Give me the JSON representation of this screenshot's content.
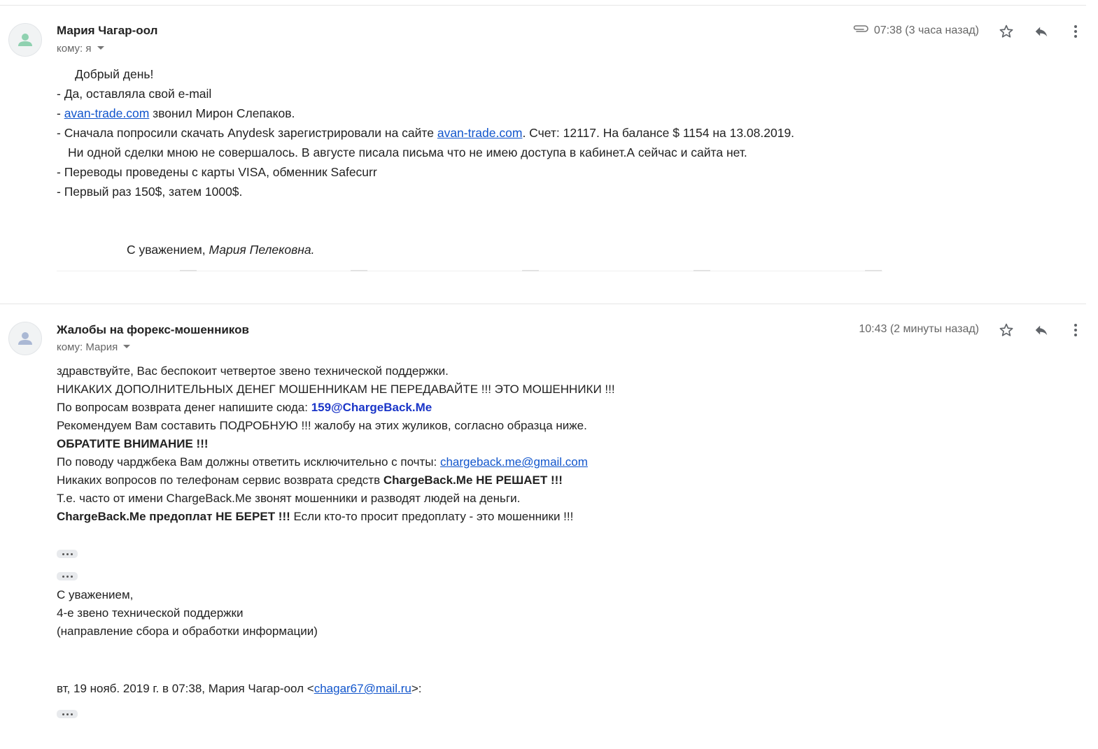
{
  "message1": {
    "sender": "Мария Чагар-оол",
    "recipient": "кому: я",
    "time": "07:38 (3 часа назад)",
    "icons": [
      "attachment-icon",
      "star-icon",
      "reply-icon",
      "more-vert-icon"
    ],
    "lines": {
      "greeting": "Добрый день!",
      "l2": "- Да, оставляла свой e-mail",
      "l3_prefix": "- ",
      "l3_link": "avan-trade.com",
      "l3_suffix": " звонил Мирон Слепаков.",
      "l4_prefix": "- Сначала попросили скачать Anydesk зарегистрировали на сайте ",
      "l4_link": "avan-trade.com",
      "l4_suffix": ". Счет: 12117. На балансе $ 1154 на 13.08.2019.",
      "l5": "Ни одной сделки мною не совершалось. В августе писала письма что не имею доступа в кабинет.А сейчас и сайта нет.",
      "l6": "- Переводы проведены с карты VISA, обменник Safecurr",
      "l7": "- Первый раз 150$, затем 1000$."
    },
    "signature_prefix": "С уважением, ",
    "signature_name": "Мария Пелековна."
  },
  "message2": {
    "sender": "Жалобы на форекс-мошенников",
    "recipient": "кому: Мария",
    "time": "10:43 (2 минуты назад)",
    "icons": [
      "star-icon",
      "reply-icon",
      "more-vert-icon"
    ],
    "lines": {
      "l1": "здравствуйте, Вас беспокоит четвертое звено технической поддержки.",
      "l2": "НИКАКИХ ДОПОЛНИТЕЛЬНЫХ ДЕНЕГ МОШЕННИКАМ НЕ ПЕРЕДАВАЙТЕ !!! ЭТО МОШЕННИКИ !!!",
      "l3_prefix": "По вопросам возврата денег напишите сюда: ",
      "l3_email": "159@ChargeBack.Me",
      "l4": "Рекомендуем Вам составить ПОДРОБНУЮ !!! жалобу на этих жуликов, согласно образца ниже.",
      "l5": "ОБРАТИТЕ ВНИМАНИЕ !!!",
      "l6_prefix": "По поводу чарджбека Вам должны ответить исключительно с почты: ",
      "l6_link": "chargeback.me@gmail.com",
      "l7_prefix": "Никаких вопросов по телефонам сервис возврата средств ",
      "l7_bold": "ChargeBack.Me НЕ РЕШАЕТ !!!",
      "l8": "Т.е. часто от имени ChargeBack.Me звонят мошенники и разводят людей на деньги.",
      "l9_bold": "ChargeBack.Me предоплат НЕ БЕРЕТ !!!",
      "l9_suffix": " Если кто-то просит предоплату - это мошенники !!!"
    },
    "signature": {
      "l1": "С уважением,",
      "l2": "4-е звено технической поддержки",
      "l3": "(направление сбора и обработки информации)"
    },
    "quote": {
      "prefix": "вт, 19 нояб. 2019 г. в 07:38, Мария Чагар-оол <",
      "email": "chagar67@mail.ru",
      "suffix": ">:"
    }
  },
  "colors": {
    "link": "#1155cc",
    "bold_blue": "#1a35c8",
    "avatar1_person": "#8fd1b0",
    "avatar2_person": "#aab8d4",
    "muted": "#666666"
  }
}
